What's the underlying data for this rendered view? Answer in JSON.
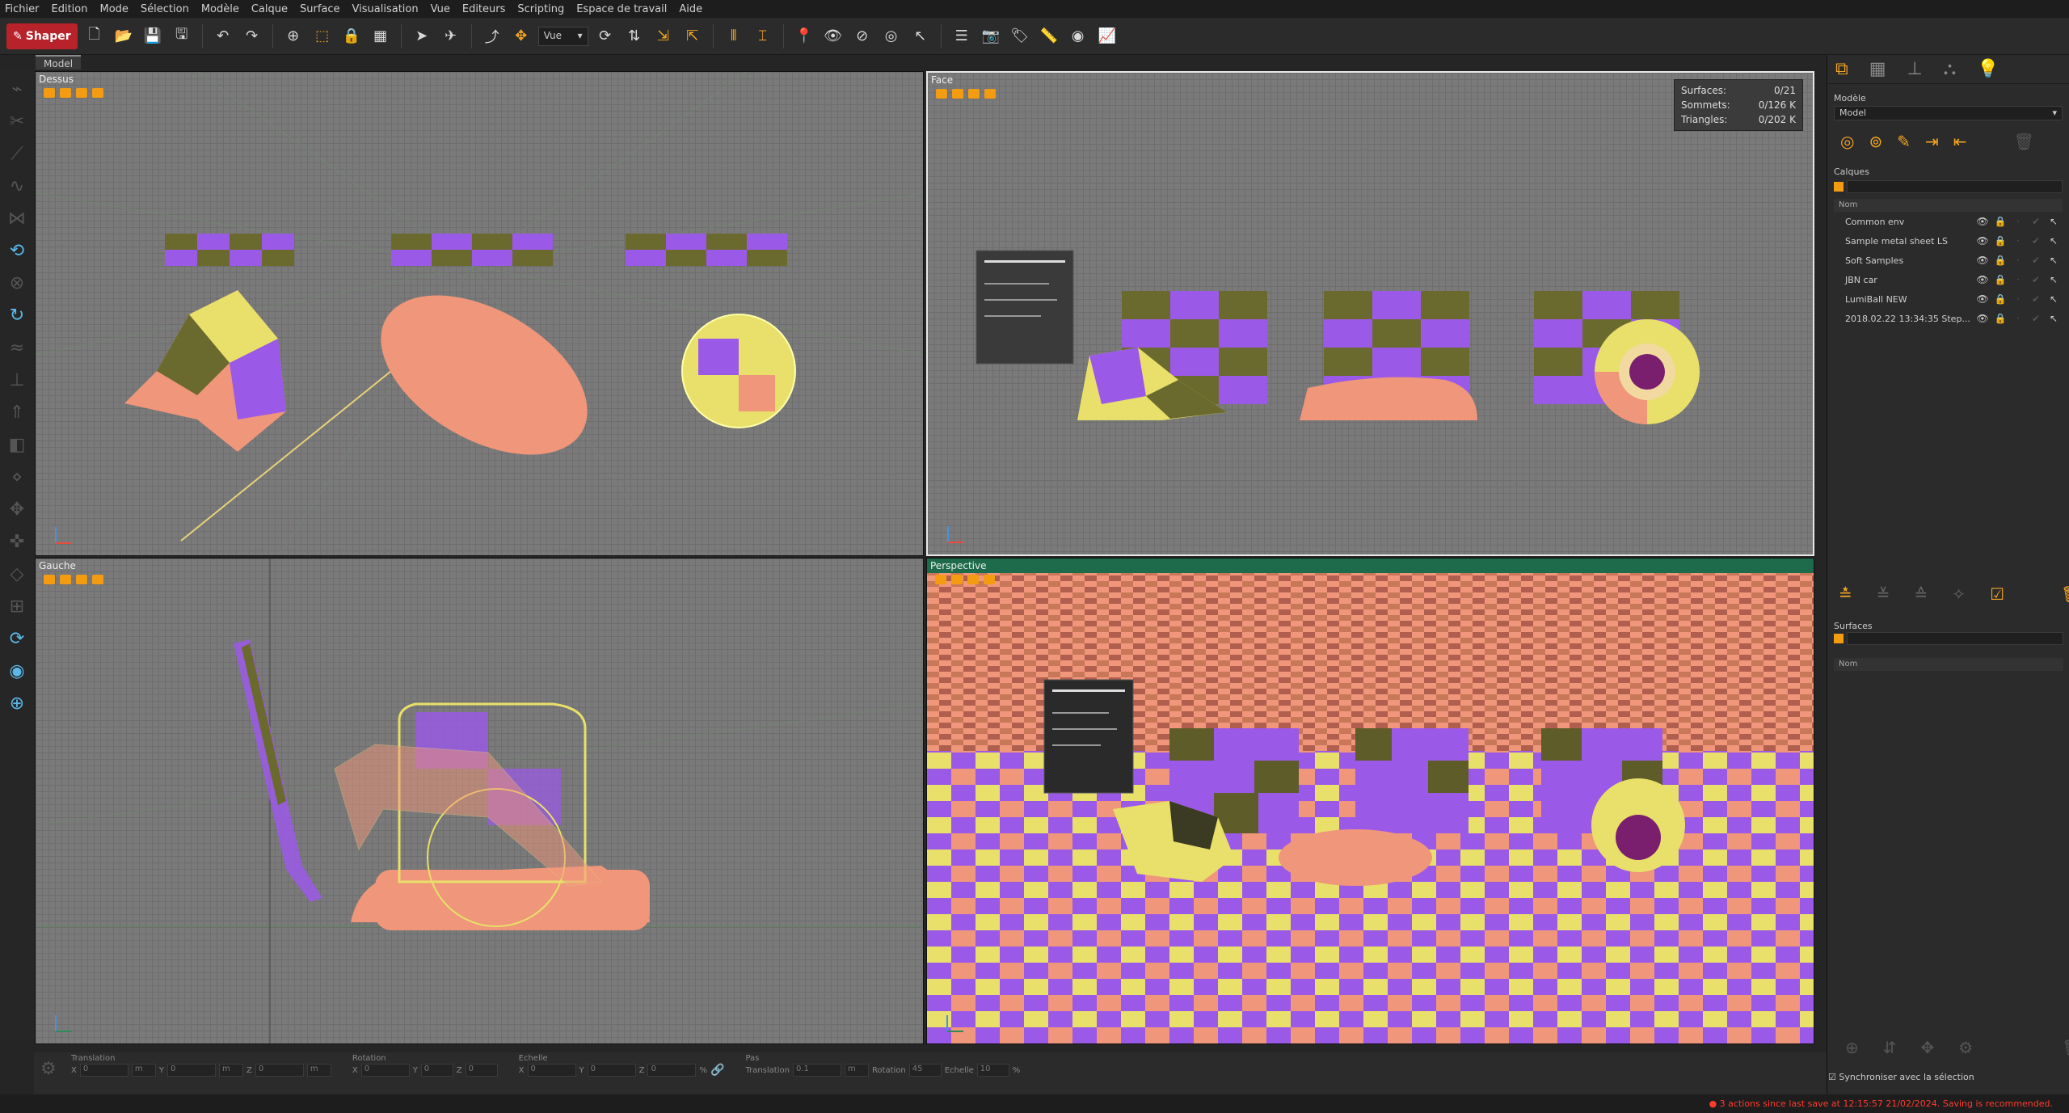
{
  "menu": [
    "Fichier",
    "Edition",
    "Mode",
    "Sélection",
    "Modèle",
    "Calque",
    "Surface",
    "Visualisation",
    "Vue",
    "Editeurs",
    "Scripting",
    "Espace de travail",
    "Aide"
  ],
  "toolbar": {
    "brand": "Shaper",
    "view_select": "Vue"
  },
  "doc_tab": "Model",
  "viewports": {
    "top": "Dessus",
    "front": "Face",
    "left": "Gauche",
    "persp": "Perspective"
  },
  "stats": {
    "surfaces_label": "Surfaces:",
    "surfaces_value": "0/21",
    "vertices_label": "Sommets:",
    "vertices_value": "0/126 K",
    "triangles_label": "Triangles:",
    "triangles_value": "0/202 K"
  },
  "panel": {
    "model_label": "Modèle",
    "model_value": "Model",
    "layers_label": "Calques",
    "name_header": "Nom",
    "layers": [
      "Common env",
      "Sample metal sheet LS",
      "Soft Samples",
      "JBN car",
      "LumiBall NEW",
      "2018.02.22 13:34:35 Step..."
    ],
    "surfaces_label": "Surfaces",
    "surfaces_name_header": "Nom",
    "sync_label": "Synchroniser avec la sélection"
  },
  "bottom": {
    "translation": "Translation",
    "rotation": "Rotation",
    "scale": "Echelle",
    "step": "Pas",
    "x": "X",
    "y": "Y",
    "z": "Z",
    "unit_m": "m",
    "zero": "0",
    "step_translation": "Translation",
    "step_translation_value": "0.1",
    "step_rotation": "Rotation",
    "step_rotation_value": "45",
    "step_scale": "Echelle",
    "step_scale_value": "10",
    "percent": "%"
  },
  "status": "3 actions since last save at 12:15:57 21/02/2024. Saving is recommended.",
  "colors": {
    "accent": "#f5a623",
    "purple": "#9b59e8",
    "salmon": "#f0967a",
    "olive": "#6b6a2e",
    "yellow": "#e8e06a",
    "checker_bg": "#7a7a7a"
  }
}
